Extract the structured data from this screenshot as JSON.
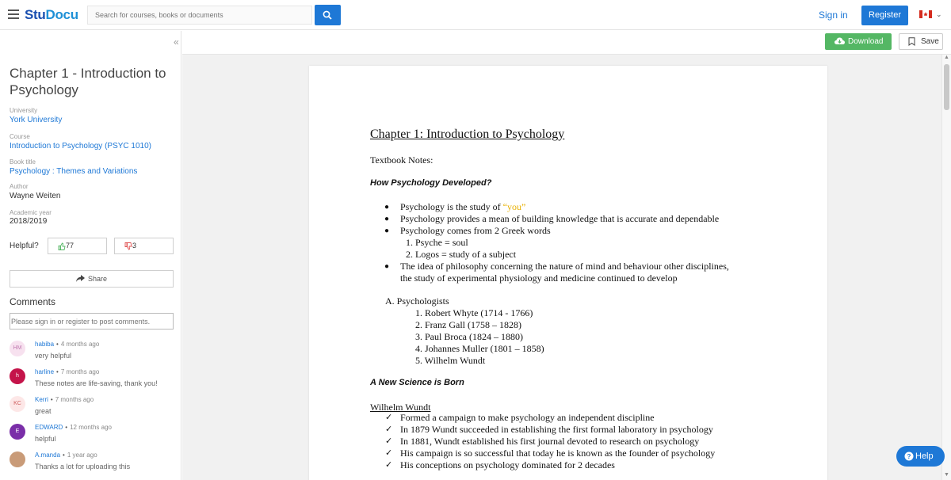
{
  "header": {
    "logo_main": "Stu",
    "logo_accent": "Docu",
    "search_placeholder": "Search for courses, books or documents",
    "sign_in": "Sign in",
    "register": "Register"
  },
  "sidebar": {
    "collapse": "«",
    "title": "Chapter 1 - Introduction to Psychology",
    "university_label": "University",
    "university": "York University",
    "course_label": "Course",
    "course": "Introduction to Psychology (PSYC 1010)",
    "book_label": "Book title",
    "book": "Psychology : Themes and Variations",
    "author_label": "Author",
    "author": "Wayne Weiten",
    "year_label": "Academic year",
    "year": "2018/2019",
    "helpful_label": "Helpful?",
    "upvotes": "77",
    "downvotes": "3",
    "share": "Share",
    "comments_heading": "Comments",
    "comment_placeholder": "Please sign in or register to post comments.",
    "comments": [
      {
        "initials": "HM",
        "author": "habiba",
        "time": "4 months ago",
        "text": "very helpful",
        "color": "#f7e1ef",
        "text_color": "#c07ab0"
      },
      {
        "initials": "h",
        "author": "harline",
        "time": "7 months ago",
        "text": "These notes are life-saving, thank you!",
        "color": "#c4144a",
        "text_color": "#ffffff"
      },
      {
        "initials": "KC",
        "author": "Kerri",
        "time": "7 months ago",
        "text": "great",
        "color": "#fde7e7",
        "text_color": "#d06060"
      },
      {
        "initials": "E",
        "author": "EDWARD",
        "time": "12 months ago",
        "text": "helpful",
        "color": "#7a2ea8",
        "text_color": "#ffffff"
      },
      {
        "initials": "",
        "author": "A.manda",
        "time": "1 year ago",
        "text": "Thanks a lot for uploading this",
        "color": "#c99b78",
        "text_color": "#ffffff"
      }
    ]
  },
  "toolbar": {
    "download": "Download",
    "save": "Save"
  },
  "document": {
    "title": "Chapter 1: Introduction to Psychology",
    "subtitle": "Textbook Notes:",
    "heading1": "How Psychology Developed?",
    "bullets": [
      "Psychology is the study of ",
      "Psychology provides a mean of building knowledge that is accurate and dependable",
      "Psychology comes from 2 Greek words"
    ],
    "you_word": "“you”",
    "greek": [
      "1.  Psyche = soul",
      "2.  Logos = study of a subject"
    ],
    "philosophy_1": "The idea of philosophy concerning the nature of mind and behaviour other disciplines,",
    "philosophy_2": "the study of experimental physiology and medicine continued to develop",
    "psychologists_heading": "A. Psychologists",
    "psychologists": [
      "1.  Robert Whyte (1714 - 1766)",
      "2.  Franz Gall (1758 – 1828)",
      "3.  Paul Broca (1824 – 1880)",
      "4.  Johannes Muller (1801 – 1858)",
      "5.  Wilhelm Wundt"
    ],
    "heading2": "A New Science is Born",
    "wundt_heading": "Wilhelm Wundt",
    "wundt_points": [
      "Formed a campaign to make psychology an independent discipline",
      "In 1879 Wundt succeeded in establishing the first formal laboratory in psychology",
      "In 1881, Wundt established his first journal devoted to research on psychology",
      "His campaign is so successful that today he is known as the founder of psychology",
      "His conceptions on psychology dominated for 2 decades"
    ]
  },
  "help": "Help",
  "colors": {
    "brand": "#1e78d6",
    "download": "#54b764"
  }
}
